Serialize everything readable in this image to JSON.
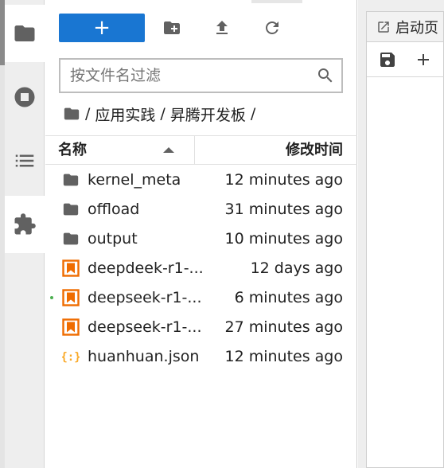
{
  "activity_bar": {
    "items": [
      {
        "icon": "folder-icon",
        "active": true
      },
      {
        "icon": "stop-circle-icon",
        "active": false
      },
      {
        "icon": "list-icon",
        "active": false
      },
      {
        "icon": "puzzle-icon",
        "active": true
      }
    ]
  },
  "toolbar": {
    "new_label": "+",
    "icons": [
      "new-folder-icon",
      "upload-icon",
      "refresh-icon"
    ],
    "accent_color": "#1976d2"
  },
  "filter": {
    "placeholder": "按文件名过滤",
    "value": ""
  },
  "breadcrumb": {
    "sep_root": "/",
    "parts": [
      "应用实践",
      "/",
      "昇腾开发板",
      "/"
    ]
  },
  "list": {
    "headers": {
      "name": "名称",
      "modified": "修改时间"
    },
    "rows": [
      {
        "icon": "folder-icon",
        "name": "kernel_meta",
        "modified": "12 minutes ago",
        "running": false
      },
      {
        "icon": "folder-icon",
        "name": "offload",
        "modified": "31 minutes ago",
        "running": false
      },
      {
        "icon": "folder-icon",
        "name": "output",
        "modified": "10 minutes ago",
        "running": false
      },
      {
        "icon": "notebook-icon",
        "name": "deepdeek-r1-...",
        "modified": "12 days ago",
        "running": false
      },
      {
        "icon": "notebook-icon",
        "name": "deepseek-r1-...",
        "modified": "6 minutes ago",
        "running": true
      },
      {
        "icon": "notebook-icon",
        "name": "deepseek-r1-...",
        "modified": "27 minutes ago",
        "running": false
      },
      {
        "icon": "json-icon",
        "name": "huanhuan.json",
        "modified": "12 minutes ago",
        "running": false
      }
    ]
  },
  "main": {
    "tab_label": "启动页",
    "panel_icons": [
      "save-icon",
      "add-icon"
    ]
  }
}
